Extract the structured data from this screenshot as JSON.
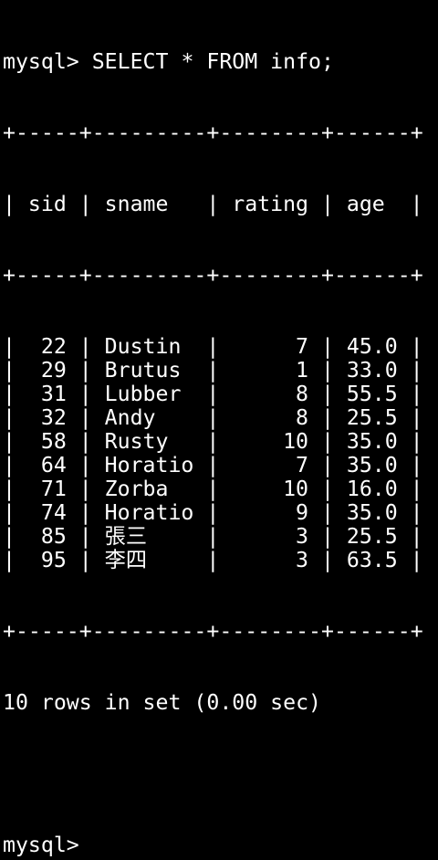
{
  "terminal": {
    "command_line": "mysql> SELECT * FROM info;",
    "border": "+-----+---------+--------+------+",
    "columns": [
      "sid",
      "sname",
      "rating",
      "age"
    ],
    "rows": [
      [
        "22",
        "Dustin",
        "7",
        "45.0"
      ],
      [
        "29",
        "Brutus",
        "1",
        "33.0"
      ],
      [
        "31",
        "Lubber",
        "8",
        "55.5"
      ],
      [
        "32",
        "Andy",
        "8",
        "25.5"
      ],
      [
        "58",
        "Rusty",
        "10",
        "35.0"
      ],
      [
        "64",
        "Horatio",
        "7",
        "35.0"
      ],
      [
        "71",
        "Zorba",
        "10",
        "16.0"
      ],
      [
        "74",
        "Horatio",
        "9",
        "35.0"
      ],
      [
        "85",
        "張三",
        "3",
        "25.5"
      ],
      [
        "95",
        "李四",
        "3",
        "63.5"
      ]
    ],
    "summary": "10 rows in set (0.00 sec)",
    "prompt": "mysql>"
  }
}
